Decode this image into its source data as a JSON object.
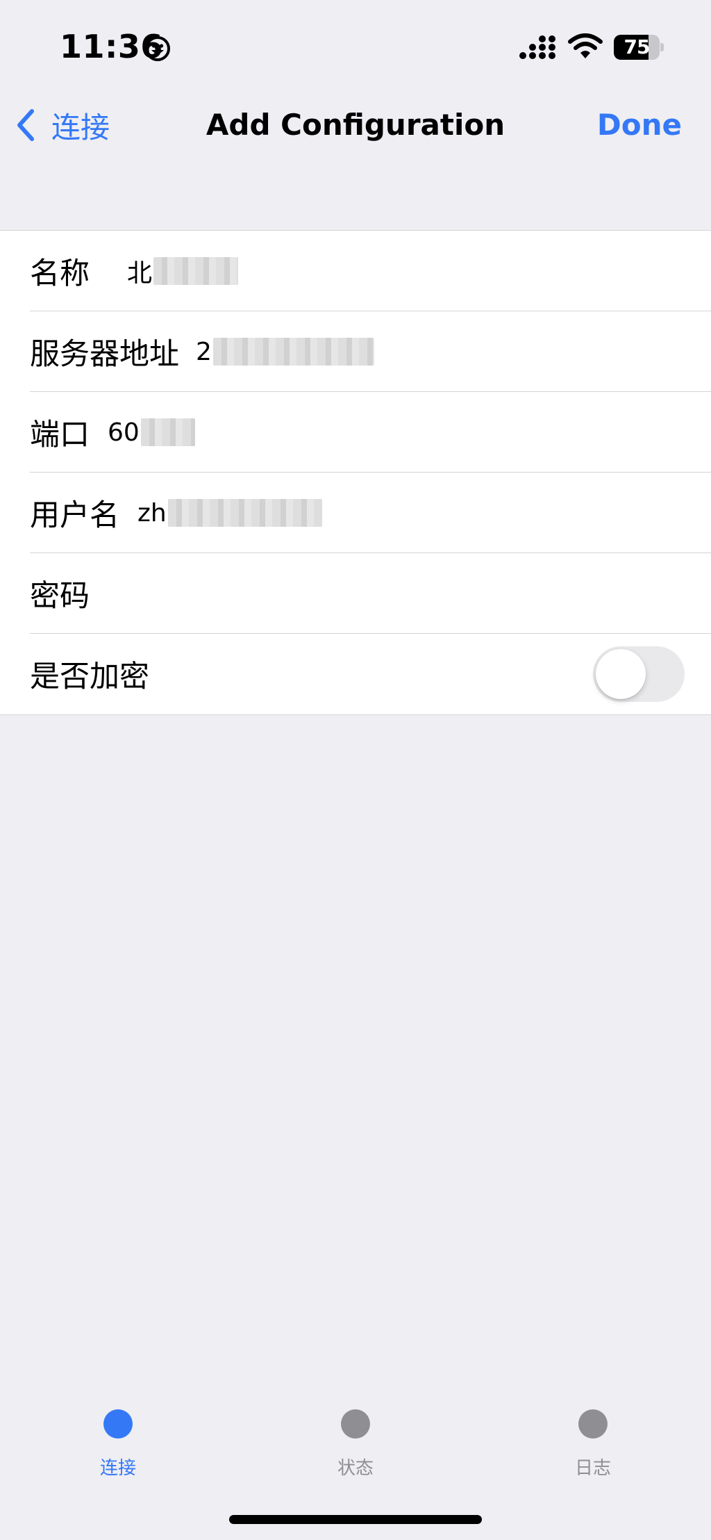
{
  "status_bar": {
    "time": "11:36",
    "battery_level": "75",
    "battery_fraction": 0.75,
    "icons": [
      "smiley-icon",
      "signal-icon",
      "wifi-icon",
      "battery-icon"
    ]
  },
  "nav": {
    "back_label": "连接",
    "title": "Add Configuration",
    "done_label": "Done"
  },
  "form": {
    "rows": [
      {
        "label": "名称",
        "value": "北"
      },
      {
        "label": "服务器地址",
        "value": "2"
      },
      {
        "label": "端口",
        "value": "60"
      },
      {
        "label": "用户名",
        "value": "zh"
      },
      {
        "label": "密码",
        "value": ""
      },
      {
        "label": "是否加密",
        "toggle_on": false
      }
    ]
  },
  "tab_bar": {
    "tabs": [
      {
        "label": "连接",
        "active": true
      },
      {
        "label": "状态",
        "active": false
      },
      {
        "label": "日志",
        "active": false
      }
    ]
  },
  "colors": {
    "accent": "#3478F6",
    "inactive": "#8E8E93",
    "background": "#EEEEF3",
    "cell": "#FFFFFF"
  }
}
